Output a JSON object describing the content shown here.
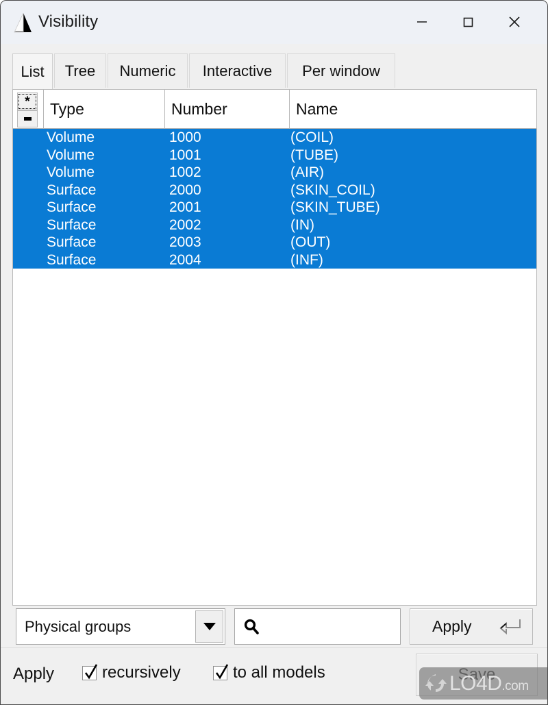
{
  "window": {
    "title": "Visibility",
    "icon": "gmsh-logo-icon",
    "controls": {
      "minimize": "minimize-icon",
      "maximize": "maximize-icon",
      "close": "close-icon"
    }
  },
  "tabs": [
    {
      "label": "List",
      "active": true
    },
    {
      "label": "Tree",
      "active": false
    },
    {
      "label": "Numeric",
      "active": false
    },
    {
      "label": "Interactive",
      "active": false
    },
    {
      "label": "Per window",
      "active": false
    }
  ],
  "list": {
    "select_all_button": "*",
    "select_none_button": "-",
    "columns": [
      "Type",
      "Number",
      "Name"
    ],
    "rows": [
      {
        "type": "Volume",
        "number": "1000",
        "name": "(COIL)",
        "selected": true
      },
      {
        "type": "Volume",
        "number": "1001",
        "name": "(TUBE)",
        "selected": true
      },
      {
        "type": "Volume",
        "number": "1002",
        "name": "(AIR)",
        "selected": true
      },
      {
        "type": "Surface",
        "number": "2000",
        "name": "(SKIN_COIL)",
        "selected": true
      },
      {
        "type": "Surface",
        "number": "2001",
        "name": "(SKIN_TUBE)",
        "selected": true
      },
      {
        "type": "Surface",
        "number": "2002",
        "name": "(IN)",
        "selected": true
      },
      {
        "type": "Surface",
        "number": "2003",
        "name": "(OUT)",
        "selected": true
      },
      {
        "type": "Surface",
        "number": "2004",
        "name": "(INF)",
        "selected": true
      }
    ]
  },
  "controls": {
    "entity_type_selected": "Physical groups",
    "search_value": "",
    "search_placeholder": "",
    "search_icon": "magnifier-icon",
    "apply_label": "Apply",
    "apply_shortcut_icon": "enter-key-icon"
  },
  "footer": {
    "apply_label": "Apply",
    "recursively_label": "recursively",
    "recursively_checked": true,
    "to_all_models_label": "to all models",
    "to_all_models_checked": true,
    "save_label": "Save"
  },
  "watermark": {
    "name": "LO4D",
    "suffix": ".com"
  },
  "colors": {
    "selection_blue": "#0a7bd4",
    "selection_text": "#ffffff",
    "titlebar": "#eef1f6",
    "dialog_bg": "#f0f0f0",
    "tab_active": "#f5f5f5",
    "tab_inactive": "#efefef"
  }
}
